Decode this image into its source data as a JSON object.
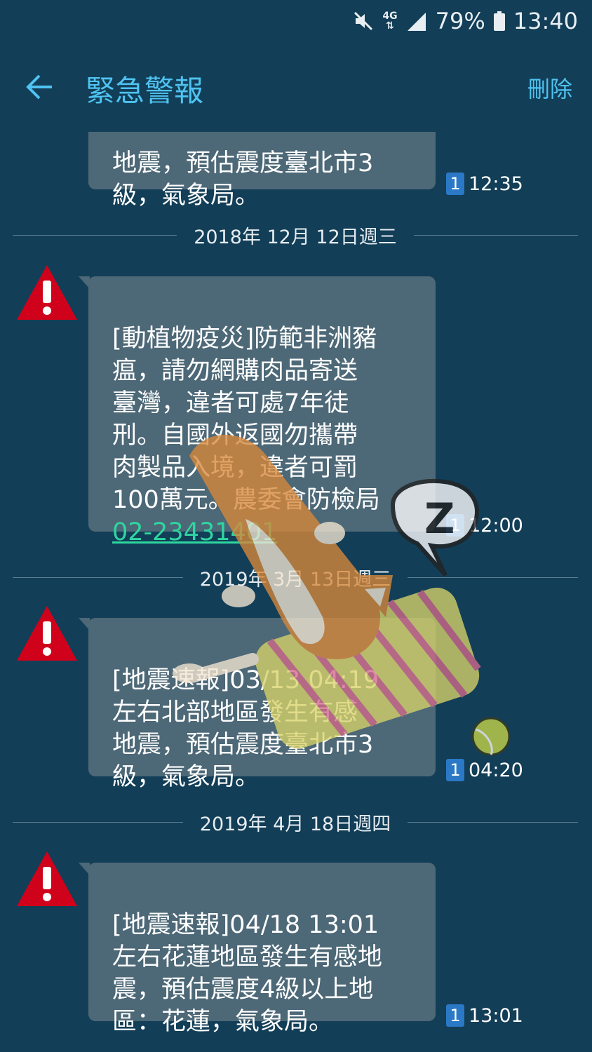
{
  "status_bar": {
    "network": "4G",
    "battery": "79%",
    "time": "13:40"
  },
  "app_bar": {
    "title": "緊急警報",
    "delete_label": "刪除"
  },
  "messages": [
    {
      "text": "地震，預估震度臺北市3\n級，氣象局。",
      "sim": "1",
      "time": "12:35"
    },
    {
      "date": "2018年 12月 12日週三",
      "text": "[動植物疫災]防範非洲豬\n瘟，請勿網購肉品寄送\n臺灣，違者可處7年徒\n刑。自國外返國勿攜帶\n肉製品入境，違者可罰\n100萬元。農委會防檢局\n",
      "phone": "02-23431401",
      "sim": "1",
      "time": "12:00"
    },
    {
      "date": "2019年 3月 13日週三",
      "text": "[地震速報]03/13 04:19\n左右北部地區發生有感\n地震，預估震度臺北市3\n級，氣象局。",
      "sim": "1",
      "time": "04:20"
    },
    {
      "date": "2019年 4月 18日週四",
      "text": "[地震速報]04/18 13:01\n左右花蓮地區發生有感地\n震，預估震度4級以上地\n區：花蓮，氣象局。",
      "sim": "1",
      "time": "13:01"
    }
  ],
  "icons": {
    "alert": "warning-triangle-icon",
    "back": "arrow-left-icon",
    "sticker": "sleeping-dog-sticker"
  },
  "colors": {
    "background": "#123e57",
    "accent": "#4fc3f1",
    "bubble": "#4d6877",
    "alert_red": "#d0021b",
    "sim_badge": "#2b79c6",
    "link": "#2fd6a0"
  }
}
